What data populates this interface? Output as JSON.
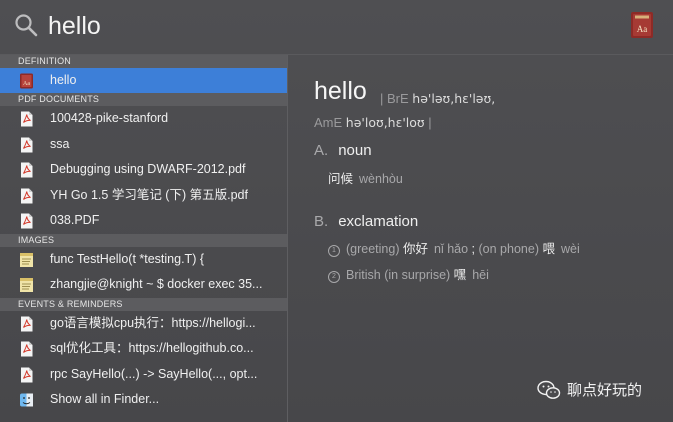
{
  "search": {
    "query": "hello"
  },
  "sections": [
    {
      "title": "DEFINITION",
      "items": [
        {
          "label": "hello",
          "icon": "dictionary-icon",
          "selected": true
        }
      ]
    },
    {
      "title": "PDF DOCUMENTS",
      "items": [
        {
          "label": "100428-pike-stanford",
          "icon": "pdf-icon"
        },
        {
          "label": "ssa",
          "icon": "pdf-icon"
        },
        {
          "label": "Debugging using DWARF-2012.pdf",
          "icon": "pdf-icon"
        },
        {
          "label": "YH Go 1.5 学习笔记 (下) 第五版.pdf",
          "icon": "pdf-icon"
        },
        {
          "label": "038.PDF",
          "icon": "pdf-icon"
        }
      ]
    },
    {
      "title": "IMAGES",
      "items": [
        {
          "label": "func TestHello(t *testing.T) {",
          "icon": "image-file-icon"
        },
        {
          "label": "zhangjie@knight ~ $ docker exec 35...",
          "icon": "image-file-icon"
        }
      ]
    },
    {
      "title": "EVENTS & REMINDERS",
      "items": [
        {
          "label": "go语言模拟cpu执行：https://hellogi...",
          "icon": "pdf-icon"
        },
        {
          "label": "sql优化工具：https://hellogithub.co...",
          "icon": "pdf-icon"
        },
        {
          "label": "rpc SayHello(...) -> SayHello(..., opt...",
          "icon": "pdf-icon"
        },
        {
          "label": "Show all in Finder...",
          "icon": "finder-icon"
        }
      ]
    }
  ],
  "definition": {
    "headword": "hello",
    "bre_label": "| BrE",
    "bre_ipa": "hə'ləʊ,hɛ'ləʊ,",
    "ame_label": "AmE",
    "ame_ipa": "hə'loʊ,hɛ'loʊ",
    "ame_bar": "|",
    "senses": [
      {
        "letter": "A.",
        "pos": "noun",
        "lines": [
          {
            "zh": "问候",
            "pinyin": "wènhòu"
          }
        ]
      },
      {
        "letter": "B.",
        "pos": "exclamation",
        "lines": [
          {
            "num": "1",
            "note": "(greeting)",
            "zh": "你好",
            "pinyin": "nǐ hǎo",
            "sep": ";",
            "note2": "(on phone)",
            "zh2": "喂",
            "pinyin2": "wèi"
          },
          {
            "num": "2",
            "note": "British (in surprise)",
            "zh": "嘿",
            "pinyin": "hēi"
          }
        ]
      }
    ]
  },
  "watermark": {
    "text": "聊点好玩的"
  }
}
